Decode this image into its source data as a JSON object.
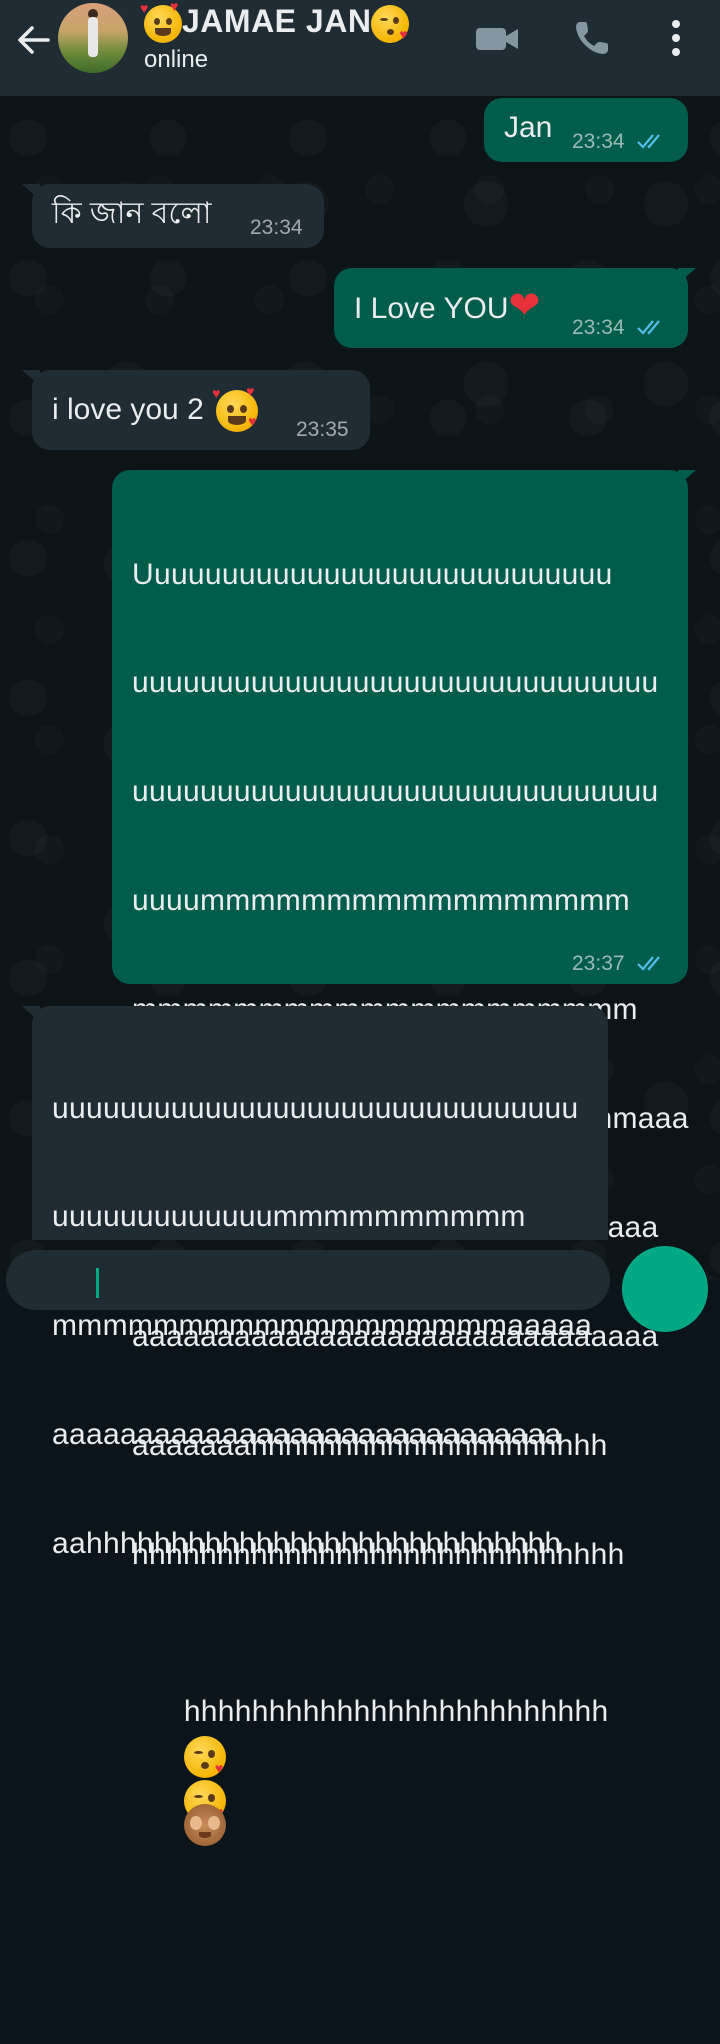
{
  "header": {
    "contact_name": "JAMAE JAN",
    "status": "online"
  },
  "colors": {
    "header_bg": "#1f2c33",
    "outgoing_bubble": "#005c4b",
    "incoming_bubble": "#202c33",
    "read_ticks": "#53bdeb",
    "accent": "#00a884"
  },
  "icons": {
    "back": "arrow-left-icon",
    "video": "video-camera-icon",
    "call": "phone-icon",
    "menu": "more-vertical-icon"
  },
  "messages": [
    {
      "direction": "out",
      "text": "Jan",
      "time": "23:34",
      "read": true
    },
    {
      "direction": "in",
      "text": "কি জান বলো",
      "time": "23:34"
    },
    {
      "direction": "out",
      "text": "I Love YOU",
      "time": "23:34",
      "read": true
    },
    {
      "direction": "in",
      "text": "i love you 2",
      "time": "23:35"
    },
    {
      "direction": "out",
      "lines": [
        "Uuuuuuuuuuuuuuuuuuuuuuuuuuuu",
        "uuuuuuuuuuuuuuuuuuuuuuuuuuuuuuu",
        "uuuuuuuuuuuuuuuuuuuuuuuuuuuuuuu",
        "uuuummmmmmmmmmmmmmmmm",
        "mmmmmmmmmmmmmmmmmmmm",
        "mmmmmmmmmmmmmmmmmmmmaaa",
        "aaaaaaaaaaaaaaaaaaaaaaaaaaaaaaa",
        "aaaaaaaaaaaaaaaaaaaaaaaaaaaaaaa",
        "aaaaaaahhhhhhhhhhhhhhhhhhhhh",
        "hhhhhhhhhhhhhhhhhhhhhhhhhhhhh",
        "hhhhhhhhhhhhhhhhhhhhhhhhh"
      ],
      "time": "23:37",
      "read": true
    },
    {
      "direction": "in",
      "lines": [
        "uuuuuuuuuuuuuuuuuuuuuuuuuuuuuuu",
        "uuuuuuuuuuuuummmmmmmmmm",
        "mmmmmmmmmmmmmmmmmmaaaaa",
        "aaaaaaaaaaaaaaaaaaaaaaaaaaaaaa",
        "aahhhhhhhhhhhhhhhhhhhhhhhhhhhh",
        "hhhhhhhhh"
      ]
    }
  ]
}
